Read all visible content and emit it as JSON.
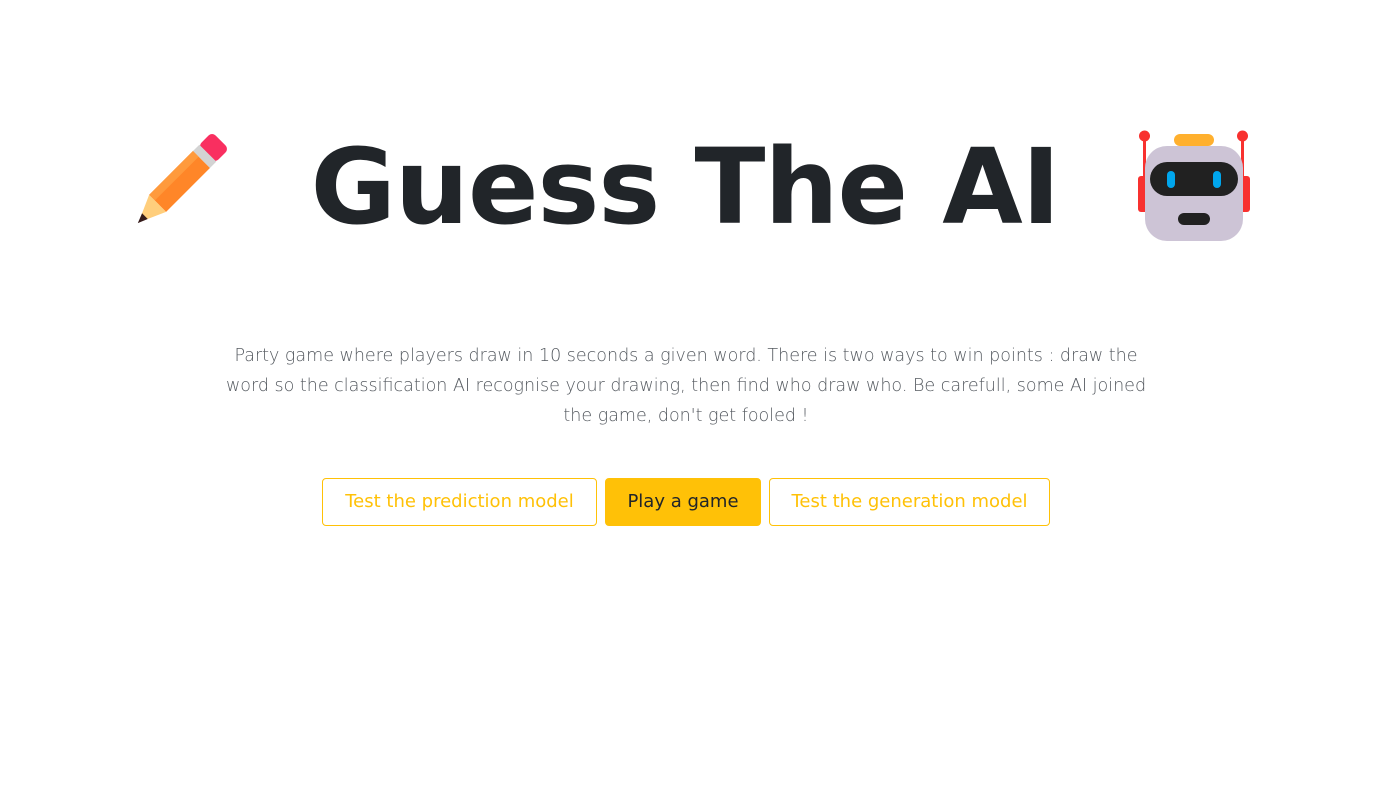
{
  "header": {
    "title": "Guess The AI"
  },
  "icons": {
    "left": "pencil-icon",
    "right": "robot-icon"
  },
  "main": {
    "description": "Party game where players draw in 10 seconds a given word. There is two ways to win points : draw the word so the classification AI recognise your drawing, then find who draw who. Be carefull, some AI joined the game, don't get fooled !"
  },
  "actions": {
    "prediction_label": "Test the prediction model",
    "play_label": "Play a game",
    "generation_label": "Test the generation model"
  },
  "colors": {
    "accent": "#ffc107",
    "text": "#212529",
    "muted": "#555a60",
    "background": "#ffffff"
  }
}
